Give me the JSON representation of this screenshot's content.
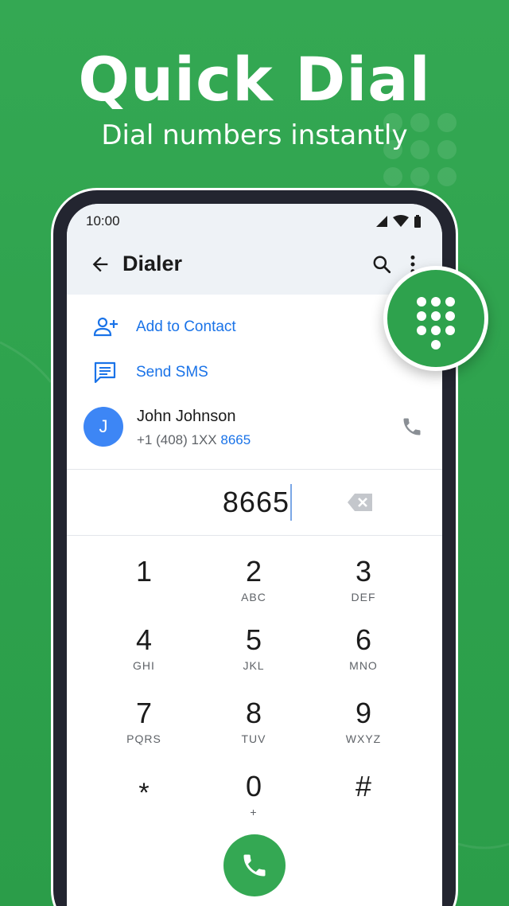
{
  "hero": {
    "title": "Quick Dial",
    "subtitle": "Dial numbers instantly"
  },
  "status_bar": {
    "time": "10:00",
    "icons": [
      "signal-icon",
      "wifi-icon",
      "battery-icon"
    ]
  },
  "app_bar": {
    "title": "Dialer",
    "back_icon": "arrow-back-icon",
    "search_icon": "search-icon",
    "more_icon": "more-vert-icon"
  },
  "actions": [
    {
      "label": "Add to Contact",
      "icon": "person-add-icon"
    },
    {
      "label": "Send SMS",
      "icon": "message-icon"
    }
  ],
  "contact": {
    "initial": "J",
    "name": "John Johnson",
    "number_prefix": "+1 (408) 1XX ",
    "number_match": "8665",
    "call_icon": "phone-icon"
  },
  "dial_input": {
    "value": "8665",
    "backspace_icon": "backspace-icon"
  },
  "keypad": [
    {
      "digit": "1",
      "letters": ""
    },
    {
      "digit": "2",
      "letters": "ABC"
    },
    {
      "digit": "3",
      "letters": "DEF"
    },
    {
      "digit": "4",
      "letters": "GHI"
    },
    {
      "digit": "5",
      "letters": "JKL"
    },
    {
      "digit": "6",
      "letters": "MNO"
    },
    {
      "digit": "7",
      "letters": "PQRS"
    },
    {
      "digit": "8",
      "letters": "TUV"
    },
    {
      "digit": "9",
      "letters": "WXYZ"
    },
    {
      "digit": "*",
      "letters": ""
    },
    {
      "digit": "0",
      "letters": "+"
    },
    {
      "digit": "#",
      "letters": ""
    }
  ],
  "call_button_icon": "phone-icon",
  "dialpad_fab_icon": "dialpad-icon",
  "colors": {
    "background": "#34a853",
    "accent_blue": "#1a73e8",
    "avatar_blue": "#3d86f5",
    "call_green": "#34a853",
    "phone_frame": "#232530"
  }
}
